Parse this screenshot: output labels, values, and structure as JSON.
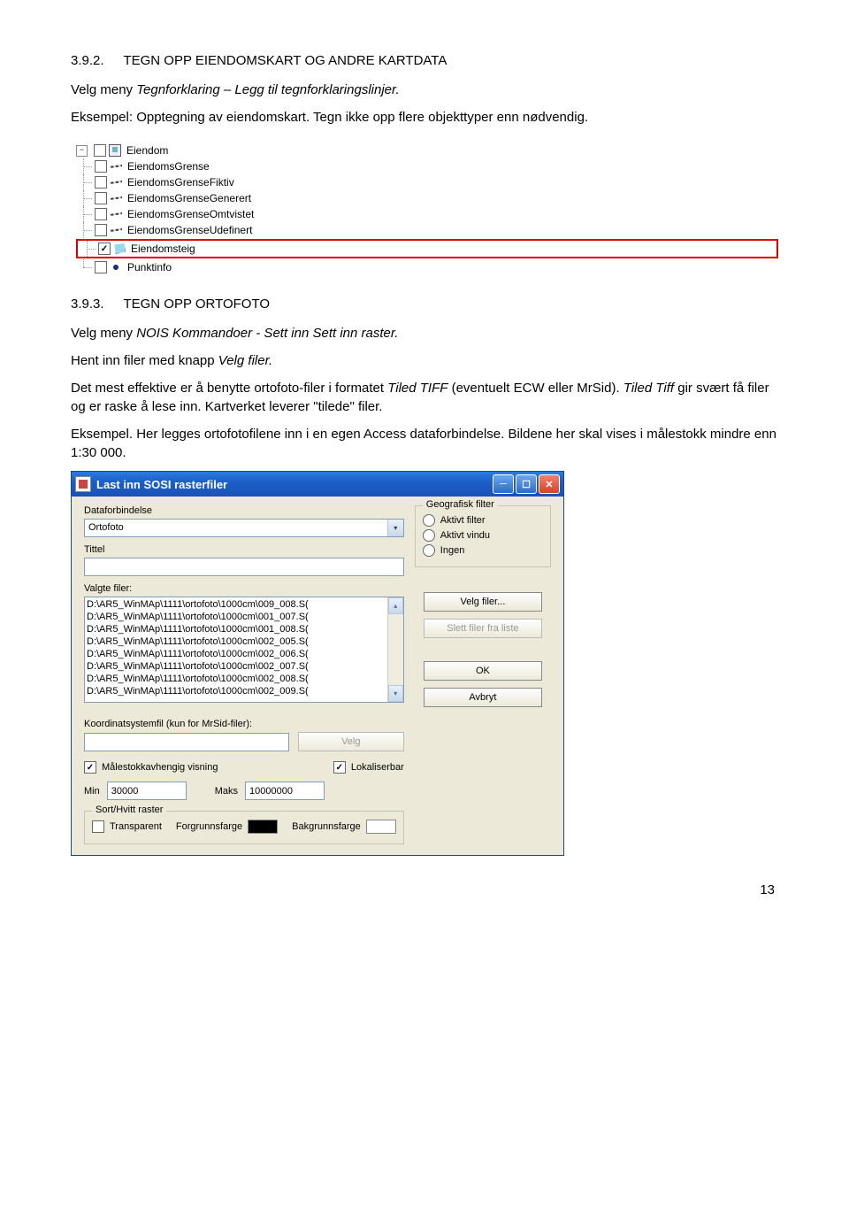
{
  "section1": {
    "num": "3.9.2.",
    "title": "TEGN OPP EIENDOMSKART OG ANDRE KARTDATA"
  },
  "para1a": "Velg meny ",
  "para1b": "Tegnforklaring – Legg til tegnforklaringslinjer.",
  "para2": "Eksempel: Opptegning av eiendomskart. Tegn ikke opp flere objekttyper enn nødvendig.",
  "tree": {
    "root": "Eiendom",
    "items": [
      "EiendomsGrense",
      "EiendomsGrenseFiktiv",
      "EiendomsGrenseGenerert",
      "EiendomsGrenseOmtvistet",
      "EiendomsGrenseUdefinert",
      "Eiendomsteig",
      "Punktinfo"
    ]
  },
  "section2": {
    "num": "3.9.3.",
    "title": "TEGN OPP ORTOFOTO"
  },
  "para3a": "Velg meny ",
  "para3b": "NOIS Kommandoer - Sett inn Sett inn raster.",
  "para4a": "Hent inn filer med knapp ",
  "para4b": "Velg filer.",
  "para5a": "Det mest effektive er å benytte ortofoto-filer i formatet ",
  "para5b": "Tiled TIFF",
  "para5c": " (eventuelt ECW eller MrSid). ",
  "para5d": "Tiled Tiff",
  "para5e": " gir svært få filer og er raske å lese inn. Kartverket leverer \"tilede\" filer.",
  "para6": "Eksempel. Her legges ortofotofilene inn i en egen Access dataforbindelse. Bildene her skal vises i målestokk mindre enn 1:30 000.",
  "dialog": {
    "title": "Last inn SOSI rasterfiler",
    "dataforbindelse_label": "Dataforbindelse",
    "dataforbindelse_value": "Ortofoto",
    "tittel_label": "Tittel",
    "tittel_value": "",
    "valgte_filer_label": "Valgte filer:",
    "files": [
      "D:\\AR5_WinMAp\\1111\\ortofoto\\1000cm\\009_008.S(",
      "D:\\AR5_WinMAp\\1111\\ortofoto\\1000cm\\001_007.S(",
      "D:\\AR5_WinMAp\\1111\\ortofoto\\1000cm\\001_008.S(",
      "D:\\AR5_WinMAp\\1111\\ortofoto\\1000cm\\002_005.S(",
      "D:\\AR5_WinMAp\\1111\\ortofoto\\1000cm\\002_006.S(",
      "D:\\AR5_WinMAp\\1111\\ortofoto\\1000cm\\002_007.S(",
      "D:\\AR5_WinMAp\\1111\\ortofoto\\1000cm\\002_008.S(",
      "D:\\AR5_WinMAp\\1111\\ortofoto\\1000cm\\002_009.S("
    ],
    "geo_filter_label": "Geografisk filter",
    "radio1": "Aktivt filter",
    "radio2": "Aktivt vindu",
    "radio3": "Ingen",
    "btn_velg_filer": "Velg filer...",
    "btn_slett": "Slett filer fra liste",
    "btn_ok": "OK",
    "btn_avbryt": "Avbryt",
    "koord_label": "Koordinatsystemfil (kun for MrSid-filer):",
    "koord_value": "",
    "btn_velg": "Velg",
    "chk_malestokk": "Målestokkavhengig visning",
    "chk_lokaliserbar": "Lokaliserbar",
    "min_label": "Min",
    "min_value": "30000",
    "maks_label": "Maks",
    "maks_value": "10000000",
    "sort_hvitt_label": "Sort/Hvitt raster",
    "chk_transparent": "Transparent",
    "forgrunn_label": "Forgrunnsfarge",
    "bakgrunn_label": "Bakgrunnsfarge"
  },
  "page_number": "13"
}
